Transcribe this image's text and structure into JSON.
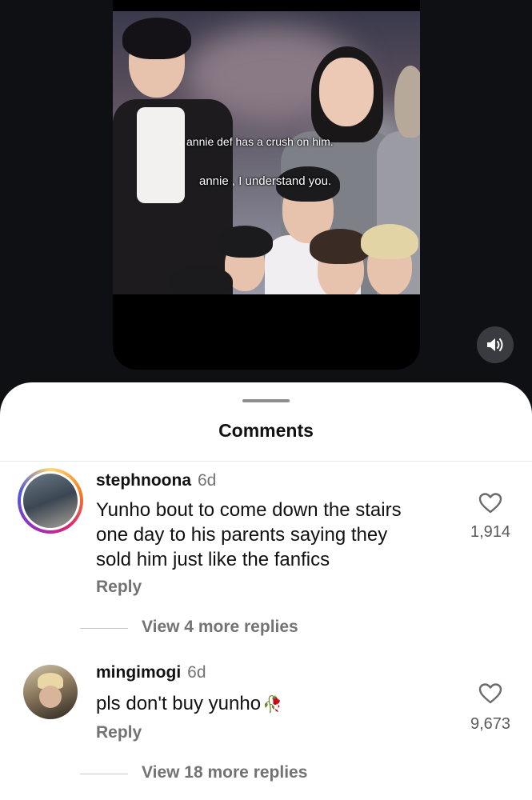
{
  "video": {
    "captions": [
      "annie def has a crush on him.",
      "annie , I understand you."
    ]
  },
  "sheet": {
    "title": "Comments"
  },
  "comments": [
    {
      "username": "stephnoona",
      "time": "6d",
      "lines": [
        "Yunho bout to come down the stairs",
        "one day to his parents saying they",
        "sold him just like the fanfics"
      ],
      "reply": "Reply",
      "likes": "1,914",
      "view_replies": "View 4 more replies",
      "avatar_ring": "#d62976"
    },
    {
      "username": "mingimogi",
      "time": "6d",
      "text": "pls don't buy yunho",
      "emoji": "🥀",
      "reply": "Reply",
      "likes": "9,673",
      "view_replies": "View 18 more replies"
    }
  ],
  "icons": [
    "speaker-icon",
    "heart-icon"
  ]
}
